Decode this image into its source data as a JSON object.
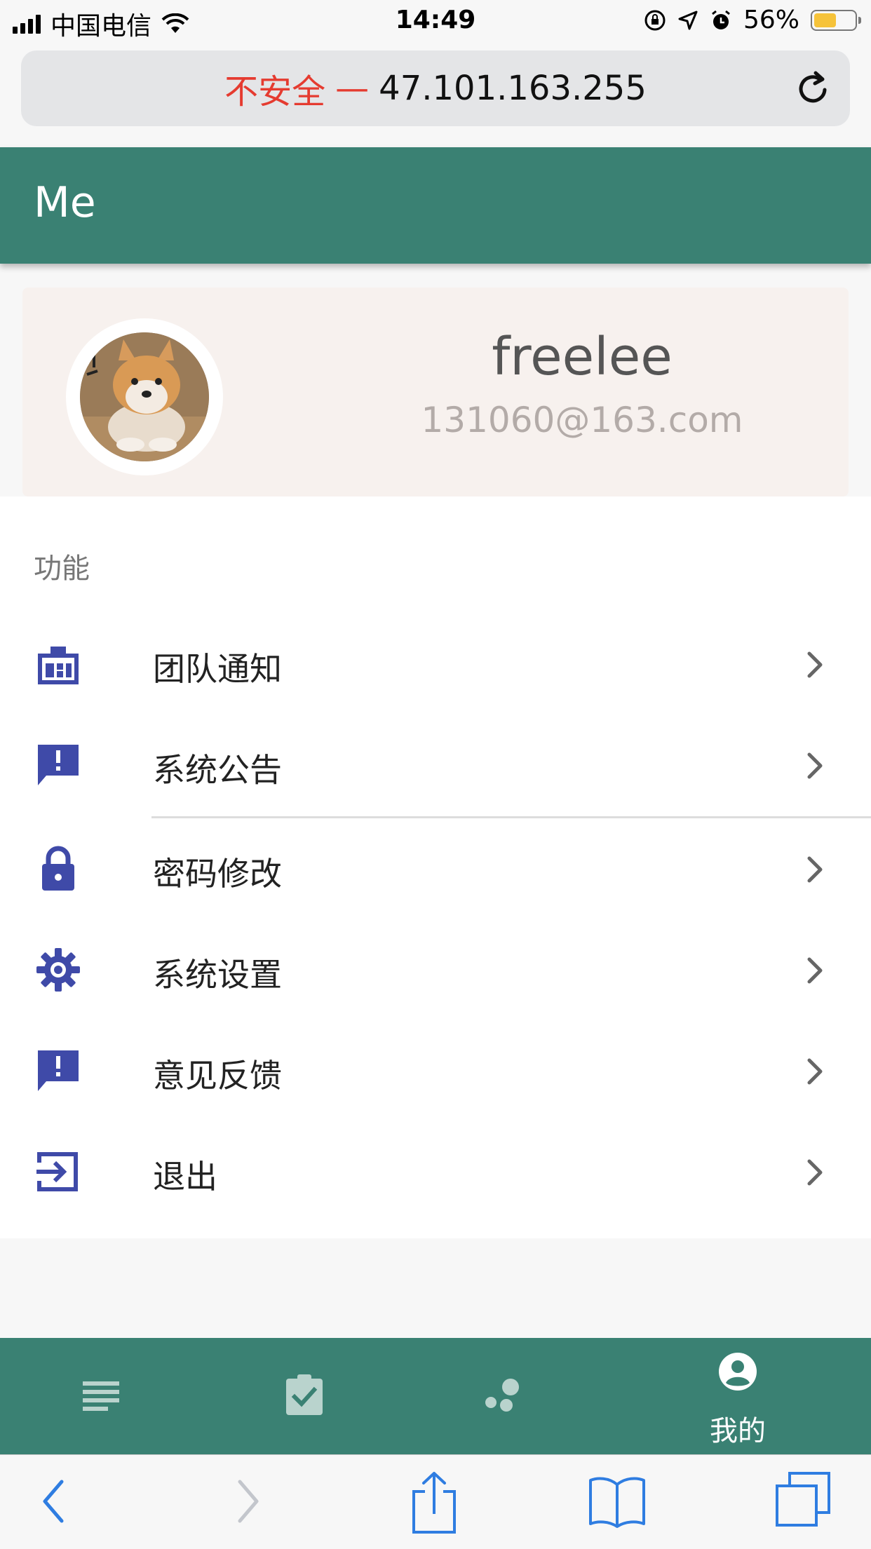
{
  "status_bar": {
    "carrier": "中国电信",
    "time": "14:49",
    "battery_percent": "56%",
    "battery_level": 0.56
  },
  "url_bar": {
    "insecure_label": "不安全",
    "separator": "—",
    "host": "47.101.163.255"
  },
  "header": {
    "title": "Me"
  },
  "profile": {
    "name": "freelee",
    "email": "131060@163.com"
  },
  "functions": {
    "section_title": "功能",
    "items": [
      {
        "label": "团队通知",
        "icon": "building-icon"
      },
      {
        "label": "系统公告",
        "icon": "announcement-icon"
      },
      {
        "label": "密码修改",
        "icon": "lock-icon"
      },
      {
        "label": "系统设置",
        "icon": "gear-icon"
      },
      {
        "label": "意见反馈",
        "icon": "feedback-icon"
      },
      {
        "label": "退出",
        "icon": "logout-icon"
      }
    ]
  },
  "tab_bar": {
    "tabs": [
      {
        "icon": "list-icon",
        "label": ""
      },
      {
        "icon": "clipboard-check-icon",
        "label": ""
      },
      {
        "icon": "bubbles-icon",
        "label": ""
      },
      {
        "icon": "account-icon",
        "label": "我的",
        "active": true
      }
    ]
  },
  "colors": {
    "primary": "#3a8173",
    "icon_blue": "#3f4aa8",
    "insecure_red": "#e53b30",
    "safari_blue": "#2f7de1"
  }
}
